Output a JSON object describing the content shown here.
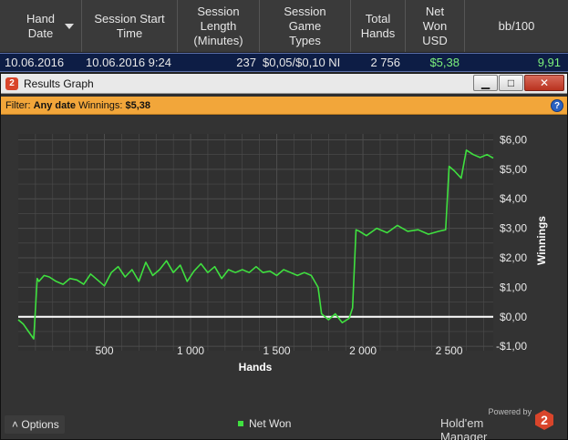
{
  "table": {
    "columns": [
      {
        "label": "Hand\nDate",
        "sort": "desc"
      },
      {
        "label": "Session Start\nTime"
      },
      {
        "label": "Session\nLength\n(Minutes)"
      },
      {
        "label": "Session\nGame\nTypes"
      },
      {
        "label": "Total\nHands"
      },
      {
        "label": "Net\nWon\nUSD"
      },
      {
        "label": "bb/100"
      }
    ],
    "row": {
      "hand_date": "10.06.2016",
      "session_start": "10.06.2016 9:24",
      "length": "237",
      "game_types": "$0,05/$0,10 NI",
      "total_hands": "2 756",
      "net_won": "$5,38",
      "bb100": "9,91"
    }
  },
  "window": {
    "title": "Results Graph",
    "app_badge": "2",
    "buttons": {
      "minimize": "▁",
      "maximize": "□",
      "close": "✕"
    }
  },
  "filter": {
    "prefix": "Filter:",
    "value": "Any date",
    "winnings_label": "Winnings:",
    "winnings_value": "$5,38",
    "help": "?"
  },
  "footer": {
    "options_label": "Options",
    "options_arrow": "˄",
    "powered_by": "Powered by",
    "brand": "Hold'em Manager",
    "brand_logo": "2"
  },
  "colors": {
    "line": "#3fe03f",
    "zero_line": "#ffffff",
    "grid": "#4d4d4d",
    "filter_bg": "#f2a63a",
    "selected_row": "#0d1d45",
    "net_won_text": "#7cf07c"
  },
  "chart_data": {
    "type": "line",
    "xlabel": "Hands",
    "ylabel": "Winnings",
    "xlim": [
      0,
      2756
    ],
    "ylim": [
      -1.15,
      6.2
    ],
    "x_ticks": [
      500,
      1000,
      1500,
      2000,
      2500
    ],
    "x_tick_labels": [
      "500",
      "1 000",
      "1 500",
      "2 000",
      "2 500"
    ],
    "y_ticks": [
      -1,
      0,
      1,
      2,
      3,
      4,
      5,
      6
    ],
    "y_tick_labels": [
      "-$1,00",
      "$0,00",
      "$1,00",
      "$2,00",
      "$3,00",
      "$4,00",
      "$5,00",
      "$6,00"
    ],
    "grid": true,
    "legend_position": "bottom-center",
    "series": [
      {
        "name": "Net Won",
        "x": [
          0,
          30,
          60,
          90,
          110,
          120,
          150,
          180,
          220,
          260,
          300,
          340,
          380,
          420,
          460,
          500,
          540,
          580,
          620,
          660,
          700,
          740,
          780,
          820,
          860,
          900,
          940,
          980,
          1020,
          1060,
          1100,
          1140,
          1180,
          1220,
          1260,
          1300,
          1340,
          1380,
          1420,
          1460,
          1500,
          1540,
          1580,
          1620,
          1660,
          1700,
          1740,
          1760,
          1800,
          1840,
          1880,
          1920,
          1940,
          1960,
          1980,
          2020,
          2080,
          2140,
          2200,
          2260,
          2320,
          2380,
          2440,
          2480,
          2500,
          2530,
          2570,
          2600,
          2640,
          2680,
          2720,
          2756
        ],
        "y": [
          -0.1,
          -0.25,
          -0.5,
          -0.75,
          1.3,
          1.2,
          1.4,
          1.35,
          1.2,
          1.1,
          1.3,
          1.25,
          1.1,
          1.45,
          1.25,
          1.05,
          1.5,
          1.7,
          1.35,
          1.6,
          1.2,
          1.85,
          1.4,
          1.6,
          1.9,
          1.5,
          1.75,
          1.2,
          1.55,
          1.8,
          1.5,
          1.7,
          1.3,
          1.6,
          1.5,
          1.6,
          1.5,
          1.7,
          1.5,
          1.55,
          1.4,
          1.6,
          1.5,
          1.4,
          1.5,
          1.4,
          1.0,
          0.1,
          -0.1,
          0.1,
          -0.2,
          -0.05,
          0.3,
          2.95,
          2.9,
          2.75,
          3.0,
          2.85,
          3.1,
          2.9,
          2.95,
          2.8,
          2.9,
          2.95,
          5.1,
          4.95,
          4.7,
          5.65,
          5.5,
          5.4,
          5.5,
          5.38
        ]
      }
    ]
  }
}
